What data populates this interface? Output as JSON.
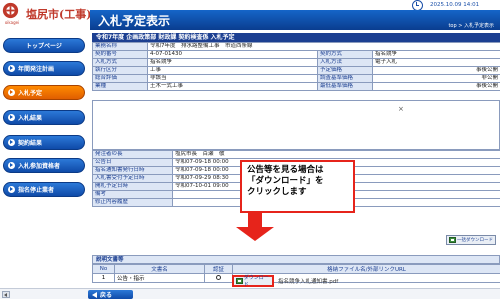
{
  "header": {
    "logo_caption": "oikagei",
    "site_name": "塩尻市(工事)",
    "page_title": "入札予定表示",
    "datetime": "2025.10.09 14:01",
    "breadcrumb": "top > 入札予定表示"
  },
  "sidebar": {
    "items": [
      {
        "label": "トップページ"
      },
      {
        "label": "年間発注計画"
      },
      {
        "label": "入札予定"
      },
      {
        "label": "入札結果"
      },
      {
        "label": "契約結果"
      },
      {
        "label": "入札参加資格者"
      },
      {
        "label": "指名停止業者"
      }
    ]
  },
  "section_header": "令和7年度  企画政策部  財政課  契約検査係  入札予定",
  "info": {
    "rows": [
      {
        "l1": "業務名称",
        "v1": "令和7年度　排水路整備工事　市道西条線",
        "l2": "",
        "v2": ""
      },
      {
        "l1": "契約番号",
        "v1": "4-07-01430",
        "l2": "契約方式",
        "v2": "指名競争"
      },
      {
        "l1": "入札方式",
        "v1": "指名競争",
        "l2": "入札方法",
        "v2": "電子入札"
      },
      {
        "l1": "執行区分",
        "v1": "工事",
        "l2": "予定価格",
        "v2": "事後公開"
      },
      {
        "l1": "総合評価",
        "v1": "非該当",
        "l2": "調査基準価格",
        "v2": "非公開"
      },
      {
        "l1": "業種",
        "v1": "土木一式工事",
        "l2": "最低基準価格",
        "v2": "事後公開"
      }
    ]
  },
  "schedule": {
    "rows": [
      {
        "label": "発注者の長",
        "value": "塩尻市長　百瀬　敬"
      },
      {
        "label": "公告日",
        "value": "令和07-09-18 00:00"
      },
      {
        "label": "指名通知書発行日時",
        "value": "令和07-09-18 00:00"
      },
      {
        "label": "入札書受付予定日時",
        "value": "令和07-09-29 08:30"
      },
      {
        "label": "開札予定日時",
        "value": "令和07-10-01 09:00"
      },
      {
        "label": "備考",
        "value": ""
      },
      {
        "label": "修正内容履歴",
        "value": ""
      }
    ]
  },
  "x_mark": "×",
  "download_all_label": "一括ダウンロード",
  "documents": {
    "title": "説明文書等",
    "headers": {
      "no": "No",
      "name": "文書名",
      "confirm": "認証",
      "file": "格納ファイル名/外部リンクURL"
    },
    "rows": [
      {
        "no": "1",
        "name": "公告・指示",
        "file": "指名競争入札通知書.pdf"
      }
    ],
    "download_label": "ダウンロード"
  },
  "callout": {
    "line1": "公告等を見る場合は",
    "line2": "「ダウンロード」を",
    "line3": "クリックします"
  },
  "footer": {
    "back_label": "戻る"
  },
  "colors": {
    "primary": "#1c3f91",
    "active": "#ff8a00",
    "highlight": "#e6241b"
  }
}
